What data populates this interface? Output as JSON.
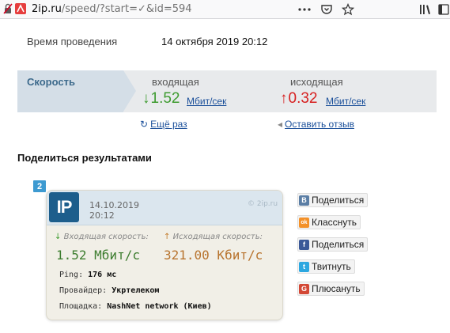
{
  "browser": {
    "url_domain": "2ip.ru",
    "url_path": "/speed/?start=✓&id=594",
    "icons": [
      "lock-icon",
      "site-icon",
      "more-icon",
      "bookmark-star-icon",
      "library-icon",
      "sidebar-icon"
    ]
  },
  "test": {
    "time_label": "Время проведения",
    "time_value": "14 октября 2019 20:12"
  },
  "speed": {
    "title": "Скорость",
    "incoming_label": "входящая",
    "incoming_arrow": "↓",
    "incoming_value": "1.52",
    "incoming_unit": "Мбит/сек",
    "outgoing_label": "исходящая",
    "outgoing_arrow": "↑",
    "outgoing_value": "0.32",
    "outgoing_unit": "Мбит/сек"
  },
  "actions": {
    "retry_icon": "↻",
    "retry_label": "Ещё раз",
    "feedback_icon": "◂",
    "feedback_label": "Оставить отзыв"
  },
  "share": {
    "title": "Поделиться результатами",
    "badge": "2",
    "buttons": [
      {
        "icon": "vk-icon",
        "glyph": "B",
        "color": "#5b7ea5",
        "label": "Поделиться"
      },
      {
        "icon": "ok-icon",
        "glyph": "ok",
        "color": "#f39129",
        "label": "Класснуть"
      },
      {
        "icon": "facebook-icon",
        "glyph": "f",
        "color": "#3b5998",
        "label": "Поделиться"
      },
      {
        "icon": "twitter-icon",
        "glyph": "t",
        "color": "#2ca7e0",
        "label": "Твитнуть"
      },
      {
        "icon": "google-plus-icon",
        "glyph": "G",
        "color": "#d34836",
        "label": "Плюсануть"
      }
    ]
  },
  "card": {
    "logo": "IP",
    "date": "14.10.2019",
    "time": "20:12",
    "watermark": "© 2ip.ru",
    "in_arrow": "↓",
    "in_label": "Входящая скорость:",
    "in_value": "1.52 Мбит/с",
    "out_arrow": "↑",
    "out_label": "Исходящая скорость:",
    "out_value": "321.00 Кбит/с",
    "ping_label": "Ping:",
    "ping_value": "176 мс",
    "provider_label": "Провайдер:",
    "provider_value": "Укртелеком",
    "site_label": "Площадка:",
    "site_value": "NashNet network (Киев)"
  },
  "colors": {
    "incoming": "#3d9b2f",
    "outgoing": "#d72020",
    "link": "#1a4f9a",
    "accent": "#1d5e8c"
  }
}
